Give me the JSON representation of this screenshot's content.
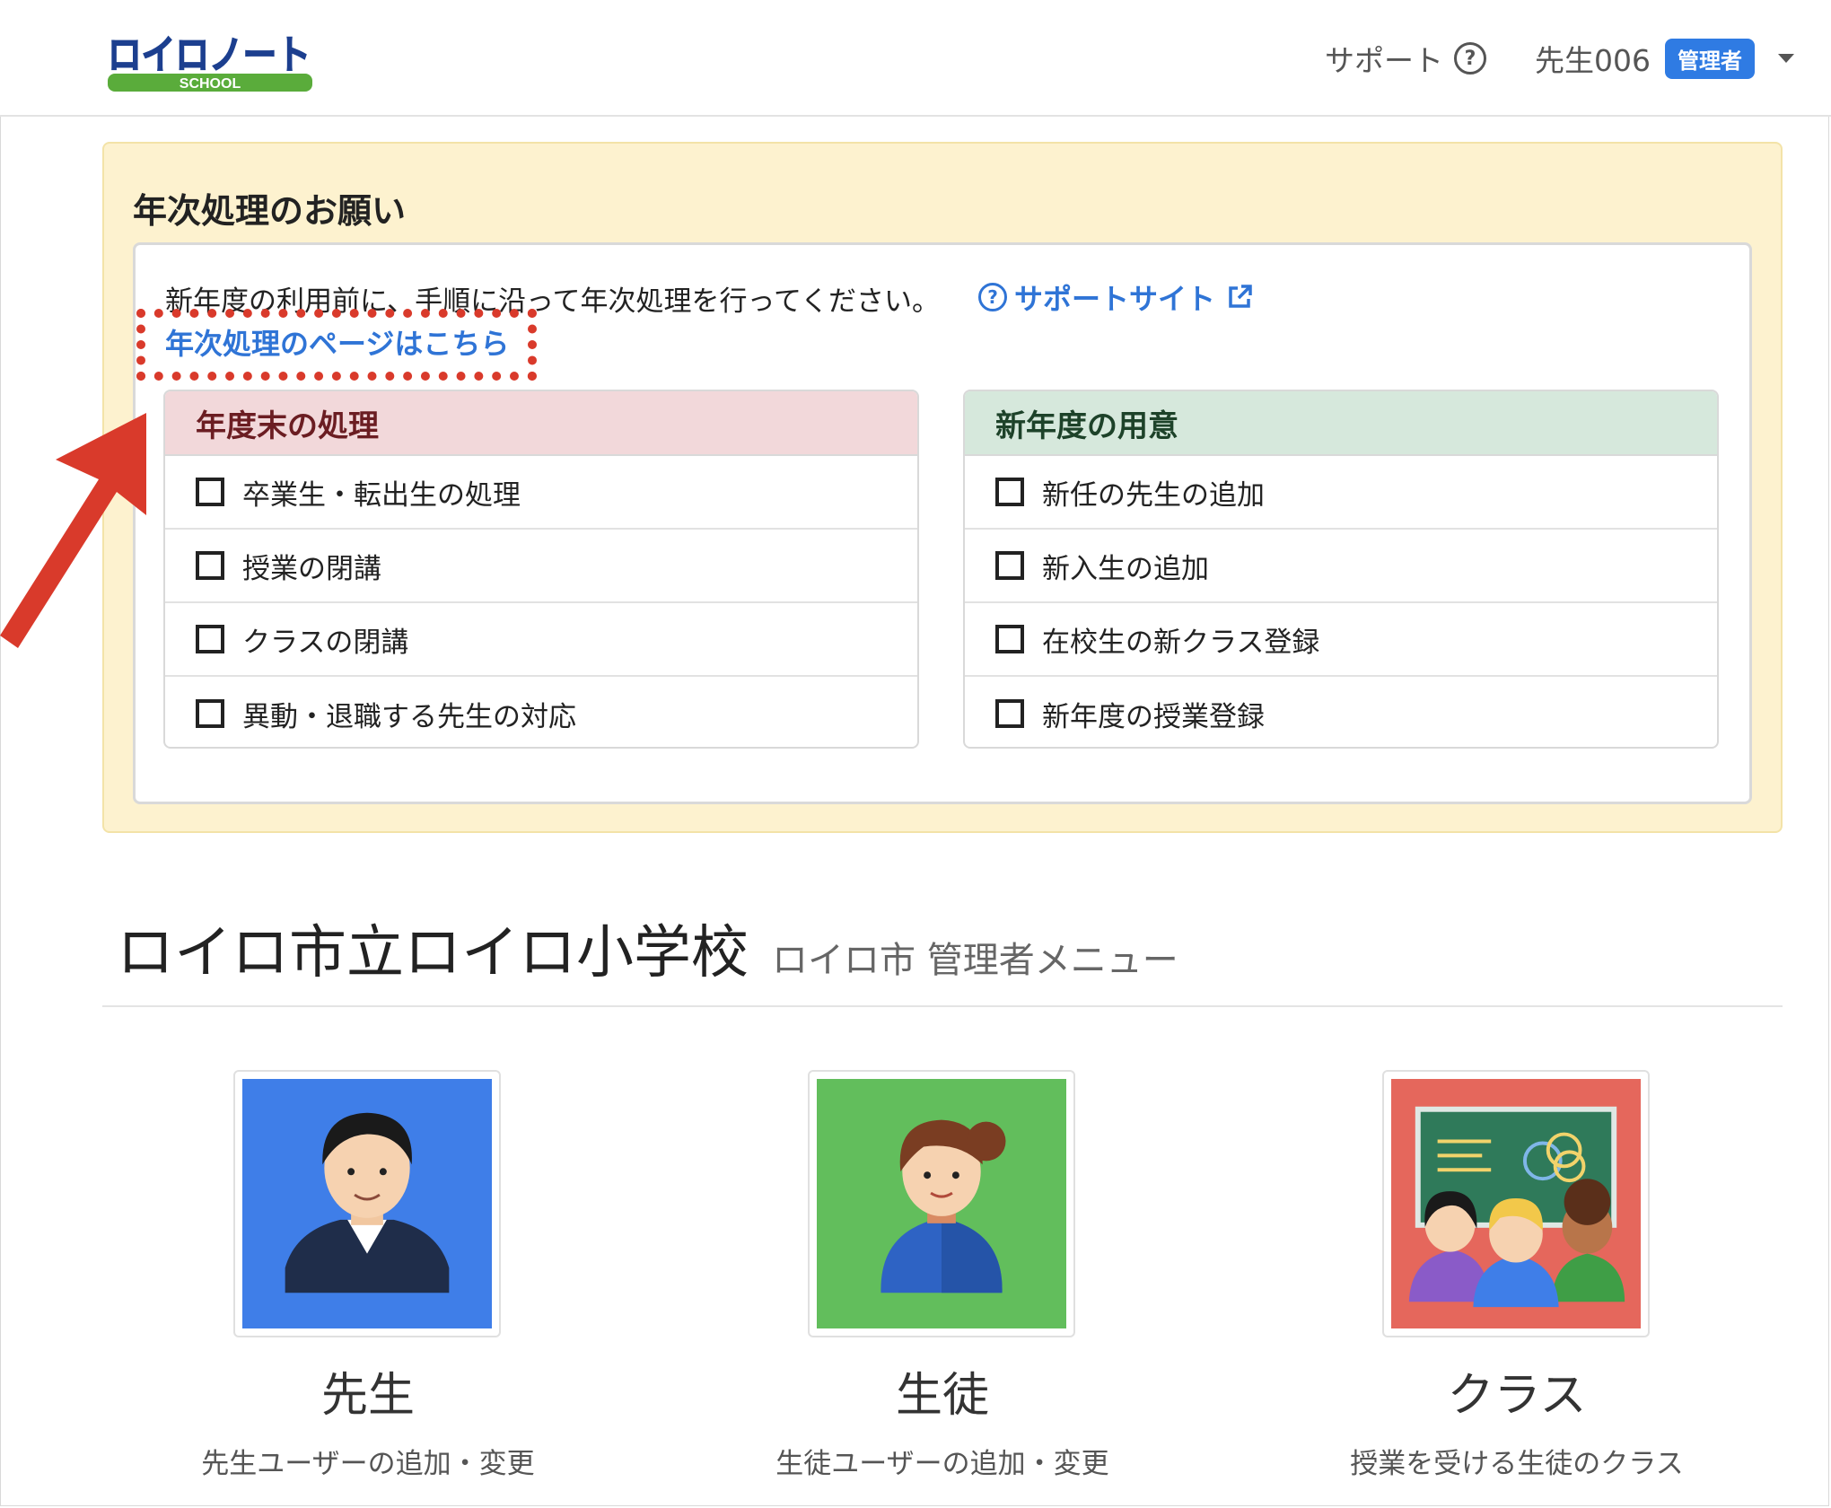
{
  "header": {
    "logo_text": "ロイロノート",
    "logo_sub": "SCHOOL",
    "support_label": "サポート",
    "user_name": "先生006",
    "role_badge": "管理者"
  },
  "notice": {
    "title": "年次処理のお願い",
    "message": "新年度の利用前に、手順に沿って年次処理を行ってください。",
    "support_site_label": "サポートサイト",
    "annual_link_label": "年次処理のページはこちら",
    "year_end": {
      "heading": "年度末の処理",
      "items": [
        "卒業生・転出生の処理",
        "授業の閉講",
        "クラスの閉講",
        "異動・退職する先生の対応"
      ]
    },
    "new_year": {
      "heading": "新年度の用意",
      "items": [
        "新任の先生の追加",
        "新入生の追加",
        "在校生の新クラス登録",
        "新年度の授業登録"
      ]
    }
  },
  "school": {
    "name": "ロイロ市立ロイロ小学校",
    "subtitle": "ロイロ市 管理者メニュー"
  },
  "tiles": [
    {
      "title": "先生",
      "desc": "先生ユーザーの追加・変更",
      "icon": "teacher-icon",
      "color": "#3f7ee8"
    },
    {
      "title": "生徒",
      "desc": "生徒ユーザーの追加・変更",
      "icon": "student-icon",
      "color": "#62be5c"
    },
    {
      "title": "クラス",
      "desc": "授業を受ける生徒のクラス",
      "icon": "class-icon",
      "color": "#e5675c"
    }
  ]
}
